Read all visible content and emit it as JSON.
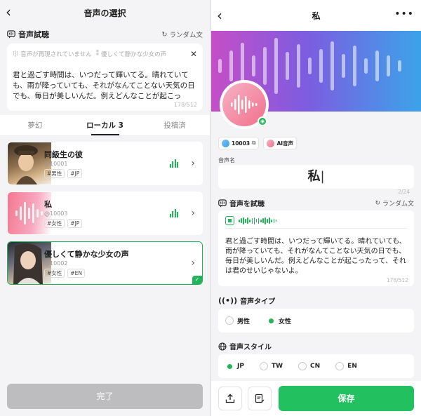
{
  "left": {
    "title": "音声の選択",
    "back_icon": "chevron-left-icon",
    "trial": {
      "label": "音声試聴",
      "random_label": "ランダム文",
      "status_text": "音声が再現されていません",
      "voice_pill": "優しくて静かな少女の声",
      "text": "君と過ごす時間は、いつだって輝いてる。晴れていても、雨が降っていても、それがなんてことない天気の日でも、毎日が美しいんだ。例えどんなことが起こっ",
      "count": "178/512"
    },
    "tabs": [
      {
        "label": "夢幻",
        "active": false
      },
      {
        "label": "ローカル 3",
        "active": true
      },
      {
        "label": "投稿済",
        "active": false
      }
    ],
    "voices": [
      {
        "name": "同級生の彼",
        "id": "@10001",
        "tags": [
          "#男性",
          "#JP"
        ],
        "playing": true,
        "selected": false
      },
      {
        "name": "私",
        "id": "@10003",
        "tags": [
          "#女性",
          "#JP"
        ],
        "playing": true,
        "selected": false
      },
      {
        "name": "優しくて静かな少女の声",
        "id": "@10002",
        "tags": [
          "#女性",
          "#EN"
        ],
        "playing": false,
        "selected": true
      }
    ],
    "done_label": "完了"
  },
  "right": {
    "title": "私",
    "more_icon": "more-horizontal-icon",
    "chips": [
      {
        "label": "10003",
        "icon": "copy-icon"
      },
      {
        "label": "AI音声",
        "icon": "ai-voice-icon"
      }
    ],
    "name_label": "音声名",
    "name_value": "私",
    "name_count": "2/24",
    "trial": {
      "label": "音声を試聴",
      "random_label": "ランダム文",
      "text": "君と過ごす時間は、いつだって輝いてる。晴れていても、雨が降っていても、それがなんてことない天気の日でも、毎日が美しいんだ。例えどんなことが起こったって、それは君のせいじゃないよ。",
      "count": "178/512"
    },
    "type": {
      "label": "音声タイプ",
      "options": [
        {
          "label": "男性",
          "selected": false
        },
        {
          "label": "女性",
          "selected": true
        }
      ]
    },
    "style": {
      "label": "音声スタイル",
      "options": [
        {
          "label": "JP",
          "selected": true
        },
        {
          "label": "TW",
          "selected": false
        },
        {
          "label": "CN",
          "selected": false
        },
        {
          "label": "EN",
          "selected": false
        }
      ]
    },
    "save_label": "保存",
    "colors": {
      "accent": "#22c05e",
      "banner_start": "#c64ec8",
      "banner_end": "#3ca3ea"
    }
  }
}
